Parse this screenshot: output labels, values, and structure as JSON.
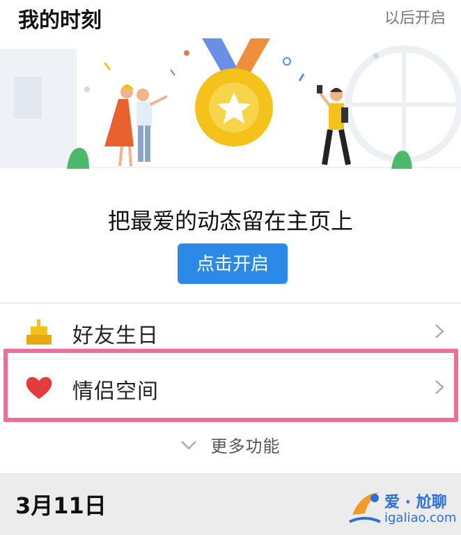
{
  "header": {
    "title": "我的时刻",
    "later_label": "以后开启"
  },
  "banner": {
    "slogan": "把最爱的动态留在主页上",
    "open_button": "点击开启"
  },
  "menu": {
    "items": [
      {
        "label": "好友生日",
        "icon": "cake-icon"
      },
      {
        "label": "情侣空间",
        "icon": "heart-icon"
      }
    ],
    "more_label": "更多功能"
  },
  "timeline": {
    "date": "3月11日"
  },
  "watermark": {
    "name": "爱 · 尬聊",
    "url": "igaliao.com"
  },
  "colors": {
    "accent": "#2a8ae6",
    "highlight": "#ec6f9a",
    "medal": "#f4c21b"
  }
}
